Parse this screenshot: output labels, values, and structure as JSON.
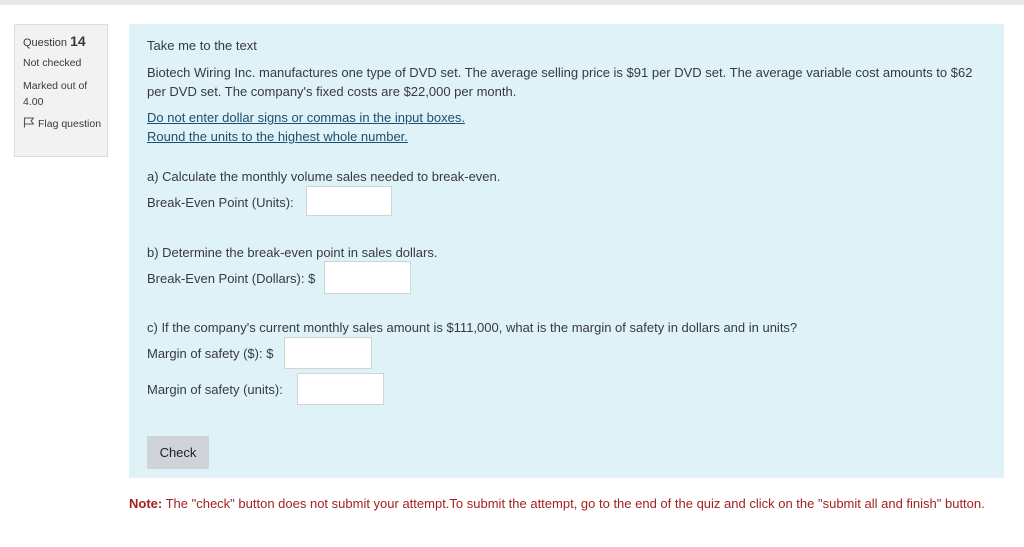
{
  "question_info": {
    "question_word": "Question",
    "question_number": "14",
    "state": "Not checked",
    "grade": "Marked out of 4.00",
    "flag_label": "Flag question"
  },
  "content": {
    "take_me_link": "Take me to the text",
    "problem_text": "Biotech Wiring Inc. manufactures one type of DVD set. The average selling price is $91 per DVD set. The average variable cost amounts to $62 per DVD set. The company's fixed costs are $22,000 per month.",
    "instruction_1": "Do not enter dollar signs or commas in the input boxes.",
    "instruction_2": "Round the units to the highest whole number.",
    "part_a_prompt": "a) Calculate the monthly volume sales needed to break-even.",
    "part_a_label": "Break-Even Point (Units):",
    "part_a_value": "",
    "part_b_prompt": "b) Determine the break-even point in sales dollars.",
    "part_b_label": "Break-Even Point (Dollars): $",
    "part_b_value": "",
    "part_c_prompt": "c) If the company's current monthly sales amount is $111,000, what is the margin of safety in dollars and in units?",
    "part_c_label_dollars": "Margin of safety ($): $",
    "part_c_value_dollars": "",
    "part_c_label_units": "Margin of safety (units):",
    "part_c_value_units": "",
    "check_button": "Check"
  },
  "note": {
    "label": "Note:",
    "text": " The \"check\" button does not submit your attempt.To submit the attempt, go to the end of the quiz and click on the \"submit all and finish\" button."
  },
  "icons": {
    "flag": "flag-icon"
  }
}
